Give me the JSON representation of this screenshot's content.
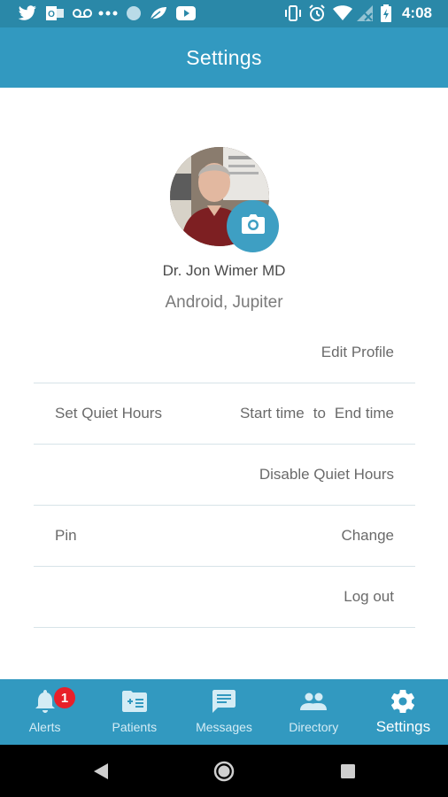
{
  "status_bar": {
    "time": "4:08",
    "icons": [
      "twitter-icon",
      "outlook-icon",
      "voicemail-icon",
      "more-dots-icon",
      "circle-app-icon",
      "leaf-icon",
      "youtube-icon",
      "vibrate-icon",
      "alarm-icon",
      "wifi-icon",
      "no-signal-icon",
      "battery-icon"
    ]
  },
  "app_bar": {
    "title": "Settings"
  },
  "profile": {
    "name": "Dr. Jon Wimer MD",
    "organization": "Android, Jupiter"
  },
  "settings": {
    "edit_profile": "Edit Profile",
    "quiet_hours": {
      "label": "Set Quiet Hours",
      "start": "Start time",
      "separator": "to",
      "end": "End time"
    },
    "disable_quiet_hours": "Disable Quiet Hours",
    "pin": {
      "label": "Pin",
      "action": "Change"
    },
    "logout": "Log out"
  },
  "bottom_nav": {
    "items": [
      {
        "label": "Alerts",
        "icon": "bell-icon",
        "badge": "1"
      },
      {
        "label": "Patients",
        "icon": "patient-card-icon"
      },
      {
        "label": "Messages",
        "icon": "message-icon"
      },
      {
        "label": "Directory",
        "icon": "people-icon"
      },
      {
        "label": "Settings",
        "icon": "gear-icon",
        "active": true
      }
    ]
  },
  "colors": {
    "primary": "#3299c0",
    "status_bar": "#2a88a8",
    "badge": "#e8202a",
    "divider": "#d7e3e8"
  }
}
